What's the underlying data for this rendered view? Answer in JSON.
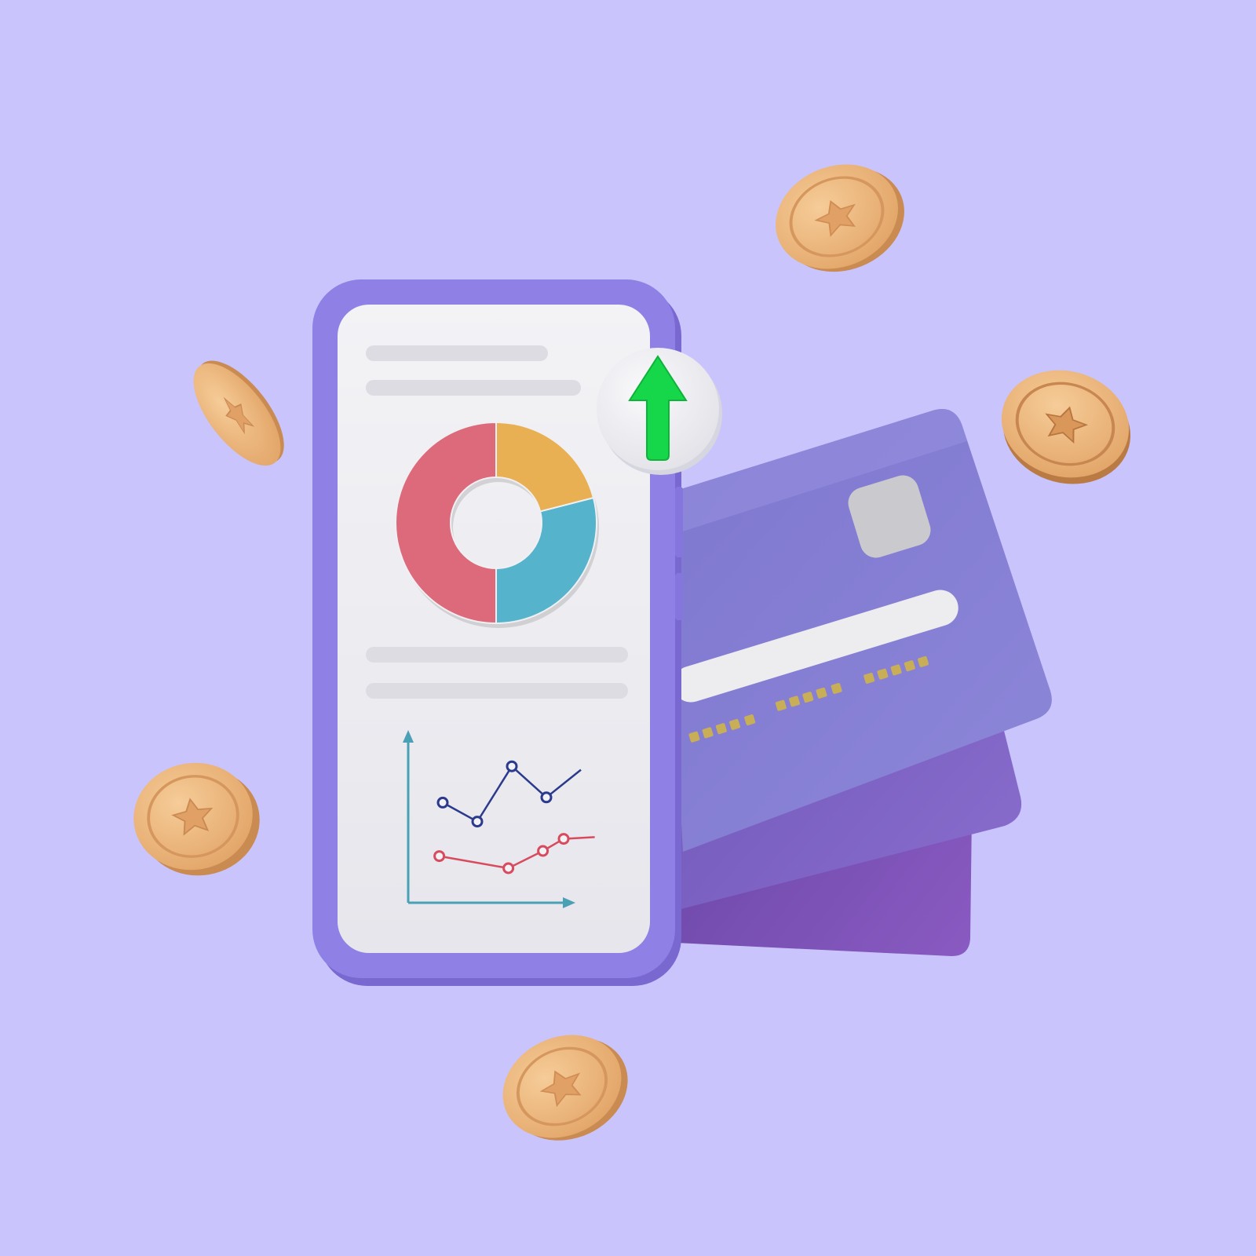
{
  "colors": {
    "background": "#C9C5FC",
    "phone_frame": "#8F80E6",
    "phone_screen": "#EDEDF2",
    "placeholder_bar": "#DCDCE2",
    "card_front": "#8B84D6",
    "card_middle": "#8268C8",
    "card_back": "#7A55B5",
    "card_chip": "#C9C9CE",
    "card_stripe": "#EDEDF0",
    "card_digits": "#C7AE57",
    "coin": "#E9B27A",
    "coin_edge": "#C98B52",
    "arrow_green": "#16D74A",
    "badge": "#EFEFF2",
    "donut_red": "#DD6A7A",
    "donut_orange": "#E8B052",
    "donut_blue": "#55B3CB",
    "axis": "#4AA0B5",
    "line_navy": "#2B3A8C",
    "line_red": "#D84A5E"
  },
  "icons": [
    "smartphone-icon",
    "donut-chart-icon",
    "line-chart-icon",
    "arrow-up-icon",
    "credit-card-icon",
    "star-coin-icon"
  ],
  "chart_data": [
    {
      "type": "pie",
      "title": "",
      "slices": [
        {
          "label": "",
          "value": 50,
          "color": "#DD6A7A"
        },
        {
          "label": "",
          "value": 21,
          "color": "#E8B052"
        },
        {
          "label": "",
          "value": 29,
          "color": "#55B3CB"
        }
      ]
    },
    {
      "type": "line",
      "title": "",
      "xlabel": "",
      "ylabel": "",
      "series": [
        {
          "color": "#2B3A8C",
          "points": [
            [
              1,
              5.8
            ],
            [
              2,
              4.7
            ],
            [
              3,
              7.9
            ],
            [
              4,
              6.1
            ],
            [
              5,
              7.7
            ]
          ],
          "marked": [
            0,
            1,
            2,
            3
          ]
        },
        {
          "color": "#D84A5E",
          "points": [
            [
              0.9,
              2.7
            ],
            [
              2.9,
              2.0
            ],
            [
              3.9,
              3.0
            ],
            [
              4.5,
              3.7
            ],
            [
              5.4,
              3.8
            ]
          ],
          "marked": [
            0,
            1,
            2,
            3
          ]
        }
      ]
    }
  ]
}
